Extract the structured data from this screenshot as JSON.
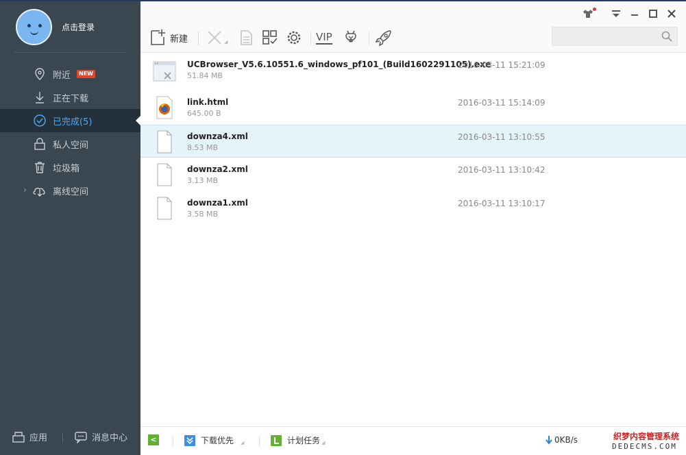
{
  "user": {
    "login_text": "点击登录"
  },
  "sidebar": {
    "items": [
      {
        "label": "附近",
        "badge": "NEW",
        "icon": "location-pin-icon"
      },
      {
        "label": "正在下载",
        "icon": "download-arrow-icon"
      },
      {
        "label": "已完成(5)",
        "icon": "check-circle-icon",
        "active": true
      },
      {
        "label": "私人空间",
        "icon": "lock-icon"
      },
      {
        "label": "垃圾箱",
        "icon": "trash-icon"
      },
      {
        "label": "离线空间",
        "icon": "cloud-download-icon"
      }
    ],
    "bottom": {
      "apps_label": "应用",
      "messages_label": "消息中心"
    }
  },
  "toolbar": {
    "new_label": "新建",
    "vip_label": "VIP"
  },
  "search": {
    "placeholder": "",
    "value": ""
  },
  "files": [
    {
      "name": "UCBrowser_V5.6.10551.6_windows_pf101_(Build1602291105).exe",
      "size": "51.84 MB",
      "date": "2016-03-11 15:21:09",
      "icon": "exe-file-icon"
    },
    {
      "name": "link.html",
      "size": "645.00 B",
      "date": "2016-03-11 15:14:09",
      "icon": "firefox-html-icon"
    },
    {
      "name": "downza4.xml",
      "size": "8.53 MB",
      "date": "2016-03-11 13:10:55",
      "icon": "file-icon",
      "selected": true
    },
    {
      "name": "downza2.xml",
      "size": "3.13 MB",
      "date": "2016-03-11 13:10:42",
      "icon": "file-icon"
    },
    {
      "name": "downza1.xml",
      "size": "3.58 MB",
      "date": "2016-03-11 13:10:17",
      "icon": "file-icon"
    }
  ],
  "statusbar": {
    "back_glyph": "<",
    "priority_label": "下载优先",
    "schedule_label": "计划任务",
    "speed": "0KB/s"
  },
  "watermark": {
    "line1": "织梦内容管理系统",
    "line2": "DEDECMS.COM"
  },
  "colors": {
    "accent": "#4fa7f2",
    "sidebar": "#3a4650",
    "selected_row": "#e5f3fb",
    "green": "#62b033",
    "badge": "#e3442d"
  }
}
